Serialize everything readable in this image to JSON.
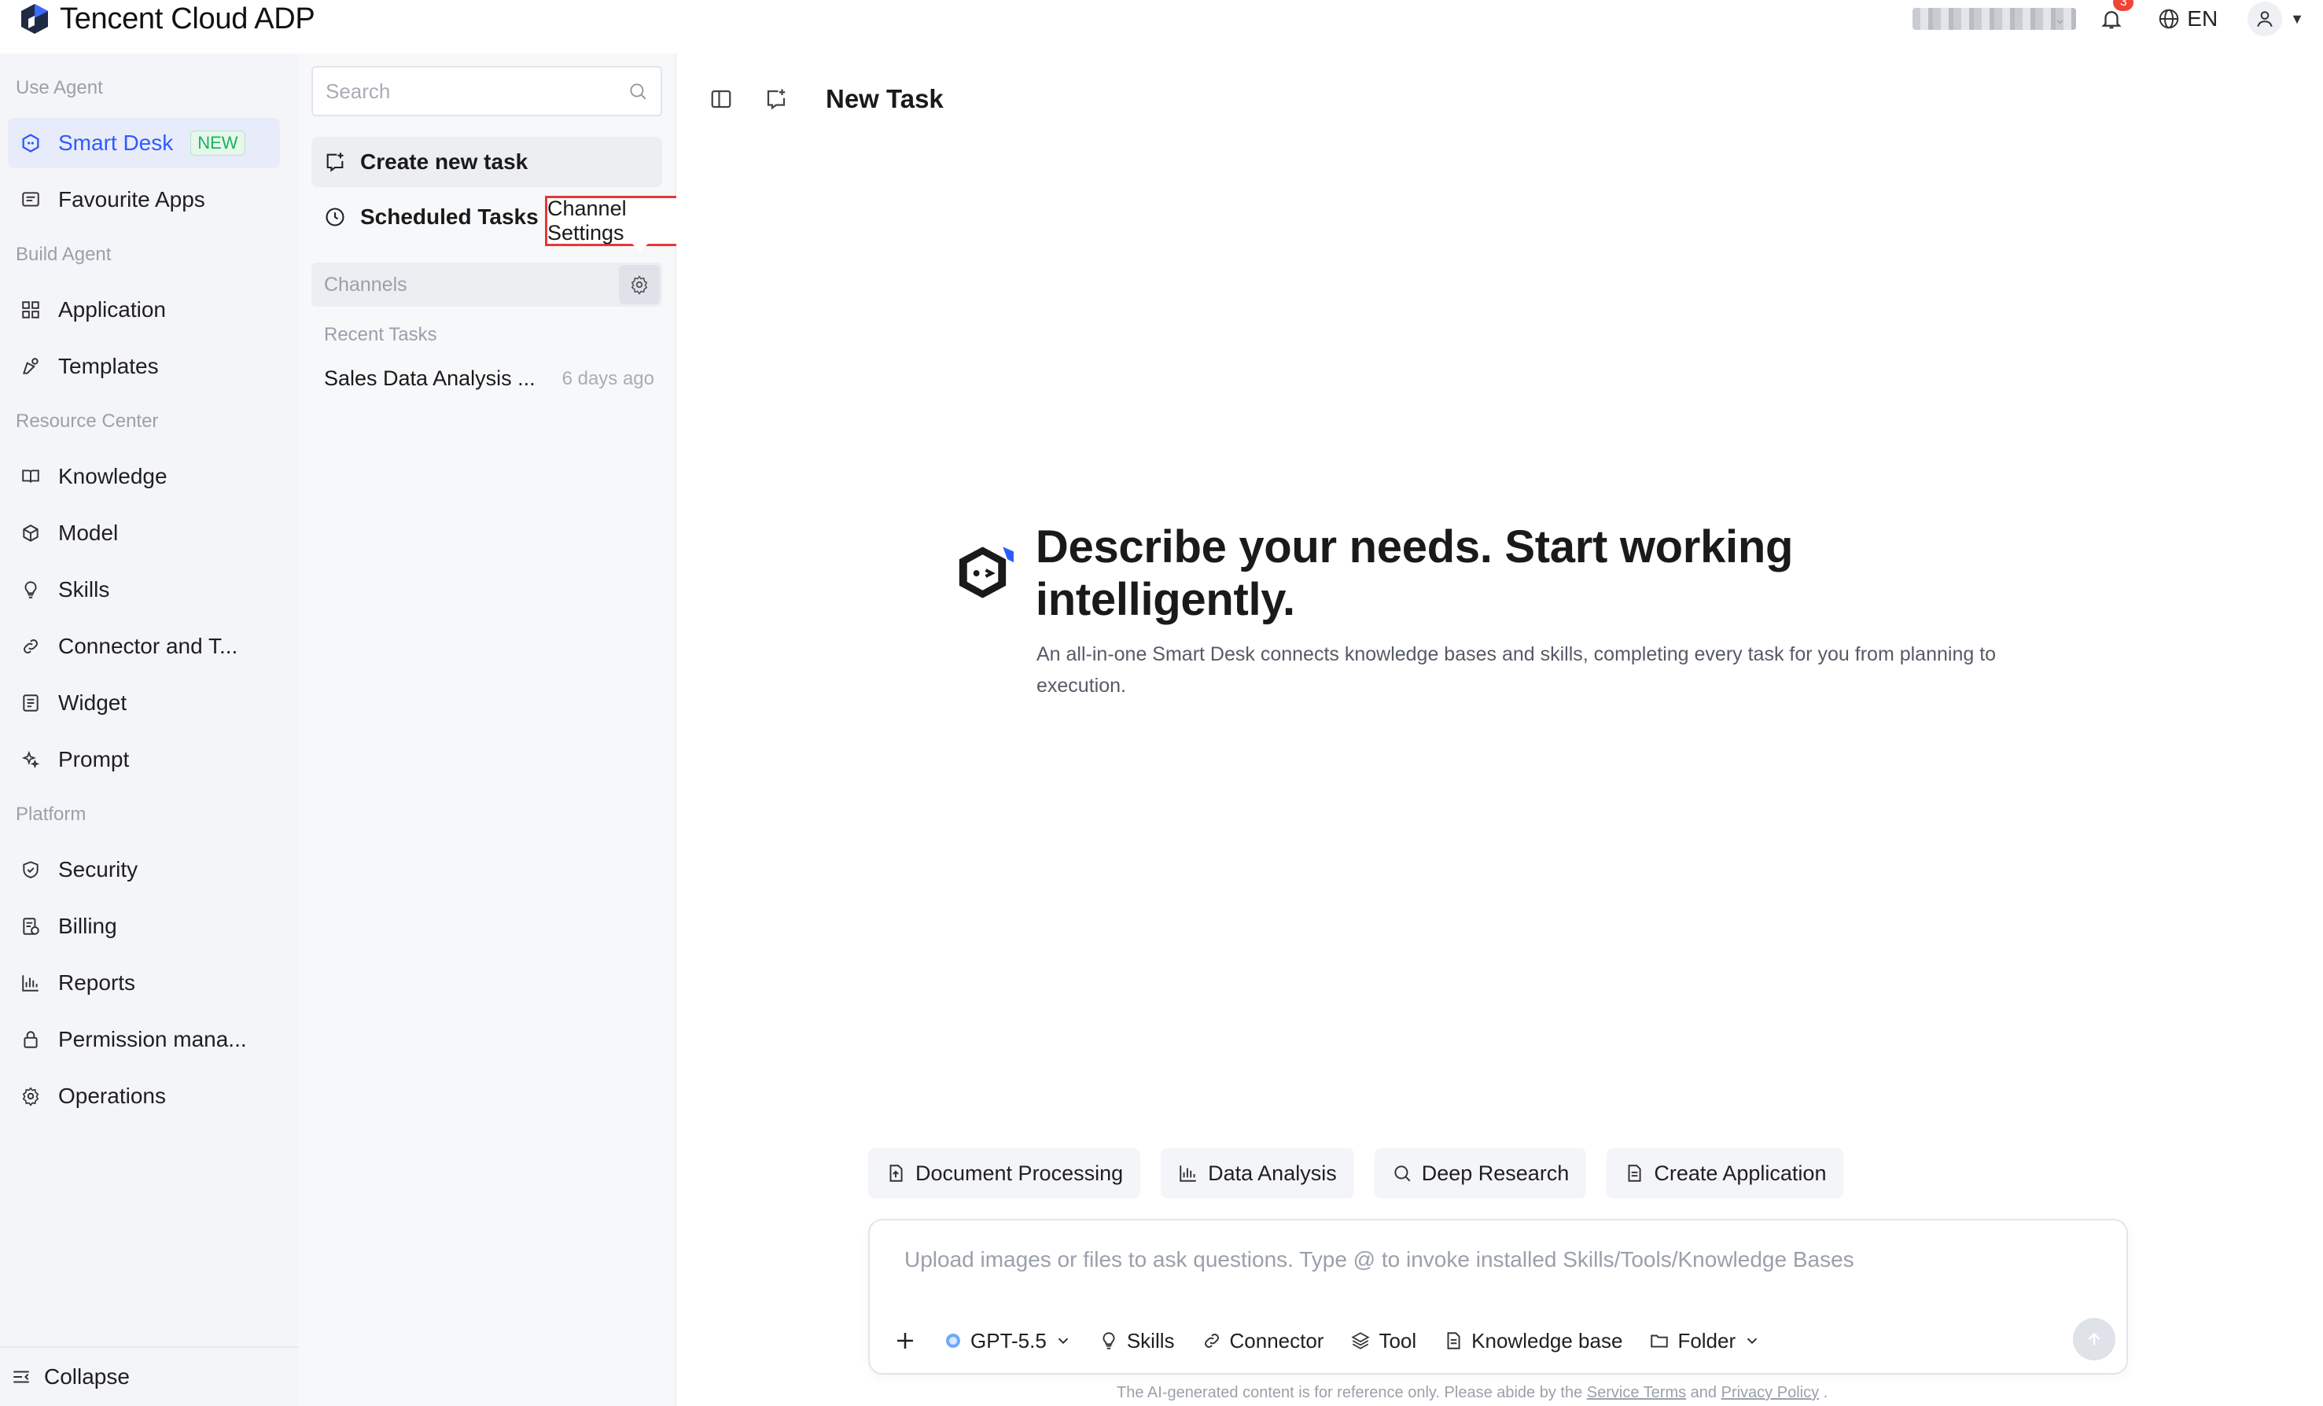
{
  "app": {
    "title": "Tencent Cloud ADP"
  },
  "topbar": {
    "notification_count": "3",
    "language": "EN"
  },
  "sidebar": {
    "sections": [
      {
        "title": "Use Agent"
      },
      {
        "title": "Build Agent"
      },
      {
        "title": "Resource Center"
      },
      {
        "title": "Platform"
      }
    ],
    "items": [
      {
        "label": "Smart Desk",
        "tag": "NEW",
        "icon": "smart-desk-icon"
      },
      {
        "label": "Favourite Apps",
        "icon": "favourite-apps-icon"
      },
      {
        "label": "Application",
        "icon": "grid-icon"
      },
      {
        "label": "Templates",
        "icon": "templates-icon"
      },
      {
        "label": "Knowledge",
        "icon": "book-icon"
      },
      {
        "label": "Model",
        "icon": "cube-icon"
      },
      {
        "label": "Skills",
        "icon": "lightbulb-icon"
      },
      {
        "label": "Connector and T...",
        "icon": "link-icon"
      },
      {
        "label": "Widget",
        "icon": "widget-icon"
      },
      {
        "label": "Prompt",
        "icon": "sparkle-icon"
      },
      {
        "label": "Security",
        "icon": "shield-icon"
      },
      {
        "label": "Billing",
        "icon": "billing-icon"
      },
      {
        "label": "Reports",
        "icon": "bar-chart-icon"
      },
      {
        "label": "Permission mana...",
        "icon": "lock-icon"
      },
      {
        "label": "Operations",
        "icon": "gear-icon"
      }
    ],
    "collapse_label": "Collapse"
  },
  "taskpanel": {
    "search_placeholder": "Search",
    "create_label": "Create new task",
    "scheduled_label": "Scheduled Tasks",
    "tooltip": "Channel Settings",
    "channels_label": "Channels",
    "recent_title": "Recent Tasks",
    "recent": [
      {
        "name": "Sales Data Analysis ...",
        "time": "6 days ago"
      }
    ]
  },
  "main": {
    "title": "New Task",
    "hero_title": "Describe your needs. Start working intelligently.",
    "hero_subtitle": "An all-in-one Smart Desk connects knowledge bases and skills, completing every task for you from planning to execution.",
    "chips": [
      {
        "label": "Document Processing",
        "icon": "document-upload-icon"
      },
      {
        "label": "Data Analysis",
        "icon": "bar-chart-icon"
      },
      {
        "label": "Deep Research",
        "icon": "search-icon"
      },
      {
        "label": "Create Application",
        "icon": "document-icon"
      }
    ],
    "composer": {
      "placeholder": "Upload images or files to ask questions. Type @ to invoke installed Skills/Tools/Knowledge Bases",
      "model": "GPT-5.5",
      "tools": [
        "Skills",
        "Connector",
        "Tool",
        "Knowledge base",
        "Folder"
      ]
    },
    "disclaimer": {
      "prefix": "The AI-generated content is for reference only. Please abide by the",
      "terms": "Service Terms",
      "and": "and",
      "privacy": "Privacy Policy",
      "suffix": "."
    }
  },
  "colors": {
    "accent": "#2e5bff",
    "new_tag": "#1bb35a",
    "tooltip_border": "#e53935",
    "badge": "#f04438"
  }
}
